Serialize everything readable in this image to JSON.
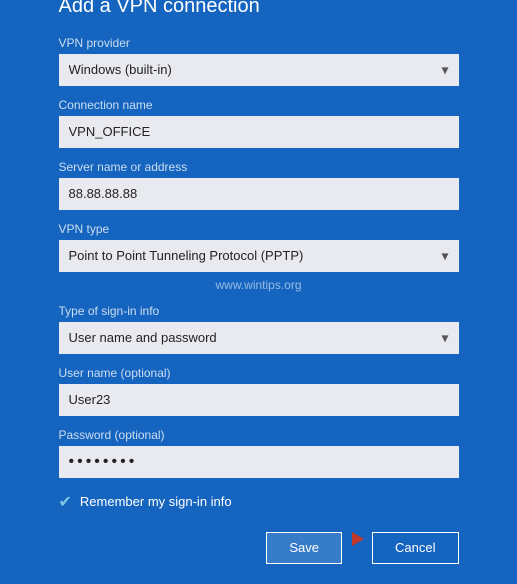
{
  "dialog": {
    "title": "Add a VPN connection"
  },
  "fields": {
    "vpn_provider_label": "VPN provider",
    "vpn_provider_value": "Windows (built-in)",
    "connection_name_label": "Connection name",
    "connection_name_value": "VPN_OFFICE",
    "server_label": "Server name or address",
    "server_value": "88.88.88.88",
    "vpn_type_label": "VPN type",
    "vpn_type_value": "Point to Point Tunneling Protocol (PPTP)",
    "signin_type_label": "Type of sign-in info",
    "signin_type_value": "User name and password",
    "username_label": "User name (optional)",
    "username_value": "User23",
    "password_label": "Password (optional)",
    "password_placeholder": "••••••••",
    "remember_label": "Remember my sign-in info"
  },
  "watermark": "www.wintips.org",
  "buttons": {
    "save": "Save",
    "cancel": "Cancel"
  }
}
